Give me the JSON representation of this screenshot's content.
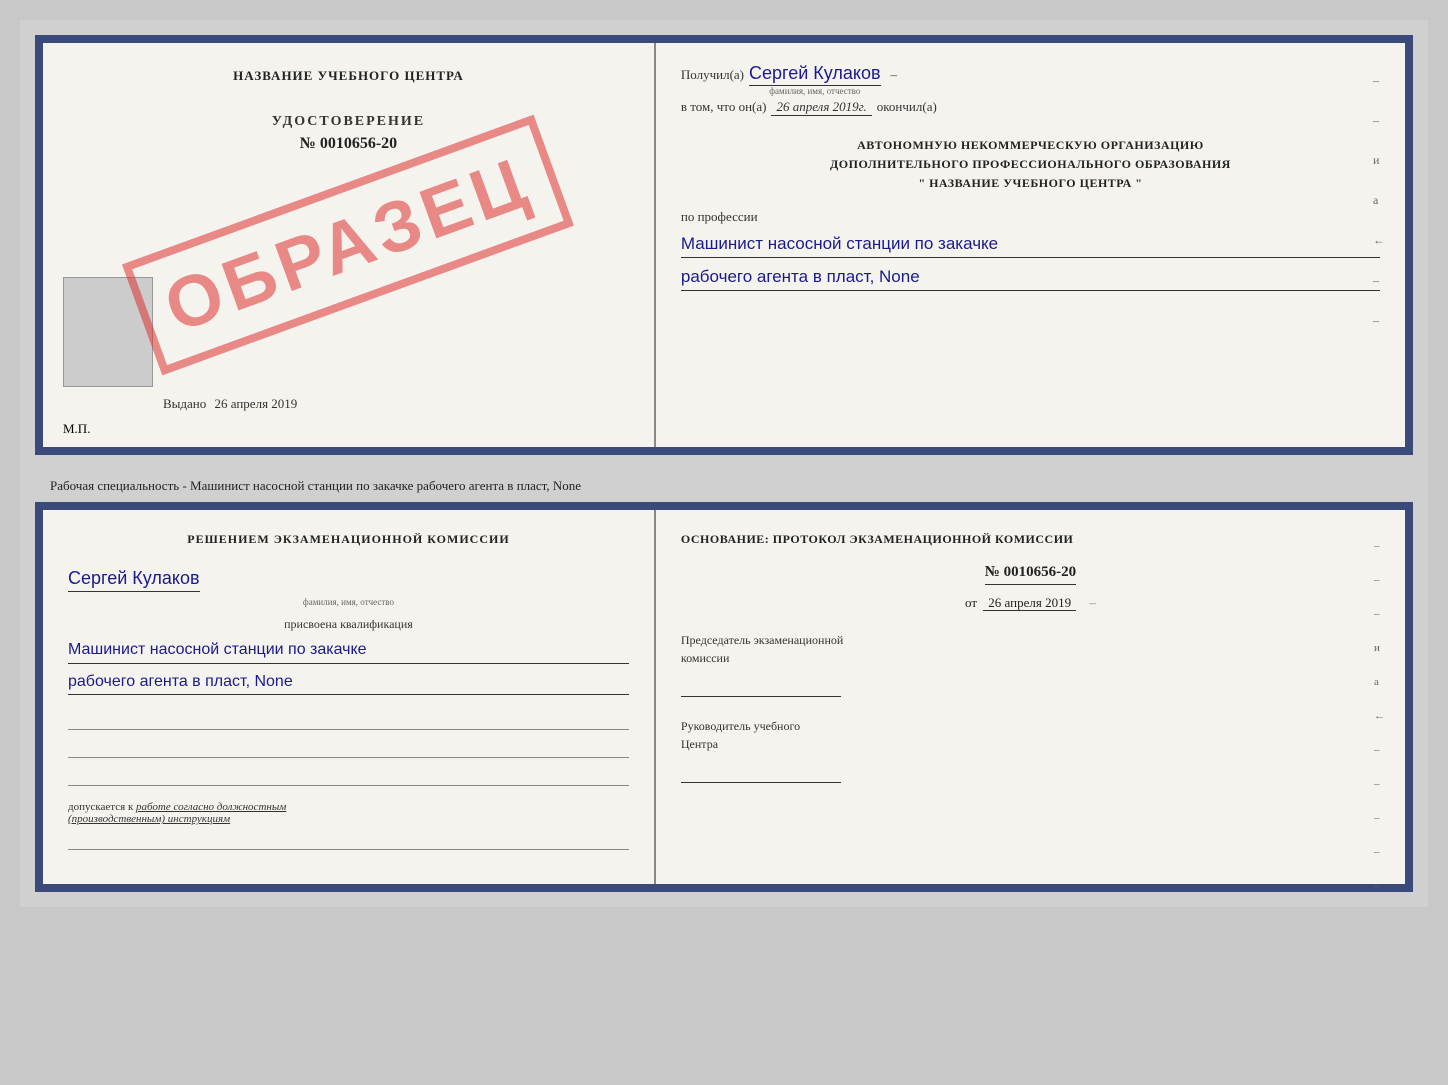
{
  "document": {
    "top": {
      "left": {
        "training_center": "НАЗВАНИЕ УЧЕБНОГО ЦЕНТРА",
        "udostoverenie_label": "УДОСТОВЕРЕНИЕ",
        "number": "№ 0010656-20",
        "vydano_label": "Выдано",
        "vydano_date": "26 апреля 2019",
        "mp_label": "М.П.",
        "watermark": "ОБРАЗЕЦ"
      },
      "right": {
        "poluchil_label": "Получил(а)",
        "recipient_name": "Сергей Кулаков",
        "recipient_name_hint": "фамилия, имя, отчество",
        "dash1": "–",
        "v_tom_label": "в том, что он(а)",
        "date_value": "26 апреля 2019г.",
        "okonchil_label": "окончил(а)",
        "org_line1": "АВТОНОМНУЮ НЕКОММЕРЧЕСКУЮ ОРГАНИЗАЦИЮ",
        "org_line2": "ДОПОЛНИТЕЛЬНОГО ПРОФЕССИОНАЛЬНОГО ОБРАЗОВАНИЯ",
        "org_line3": "\"    НАЗВАНИЕ УЧЕБНОГО ЦЕНТРА    \"",
        "po_professii": "по профессии",
        "profession_line1": "Машинист насосной станции по закачке",
        "profession_line2": "рабочего агента в пласт, None",
        "dash_items": [
          "–",
          "–",
          "–",
          "–",
          "–",
          "–"
        ]
      }
    },
    "middle_text": "Рабочая специальность - Машинист насосной станции по закачке рабочего агента в пласт,\nNone",
    "bottom": {
      "left": {
        "decision_text": "Решением  экзаменационной  комиссии",
        "person_name": "Сергей Кулаков",
        "person_name_hint": "фамилия, имя, отчество",
        "prisvoena": "присвоена квалификация",
        "qualification_line1": "Машинист насосной станции по закачке",
        "qualification_line2": "рабочего агента в пласт, None",
        "dopuskaetsya_prefix": "допускается к",
        "dopuskaetsya_italic": "работе согласно должностным\n(производственным) инструкциям"
      },
      "right": {
        "osnovaniye_label": "Основание: протокол экзаменационной комиссии",
        "protocol_number": "№ 0010656-20",
        "ot_label": "от",
        "ot_date": "26 апреля 2019",
        "predsedatel_line1": "Председатель экзаменационной",
        "predsedatel_line2": "комиссии",
        "rukovoditel_line1": "Руководитель учебного",
        "rukovoditel_line2": "Центра",
        "dash_items": [
          "–",
          "–",
          "–",
          "и",
          "а",
          "←",
          "–",
          "–",
          "–",
          "–",
          "–"
        ]
      }
    }
  }
}
